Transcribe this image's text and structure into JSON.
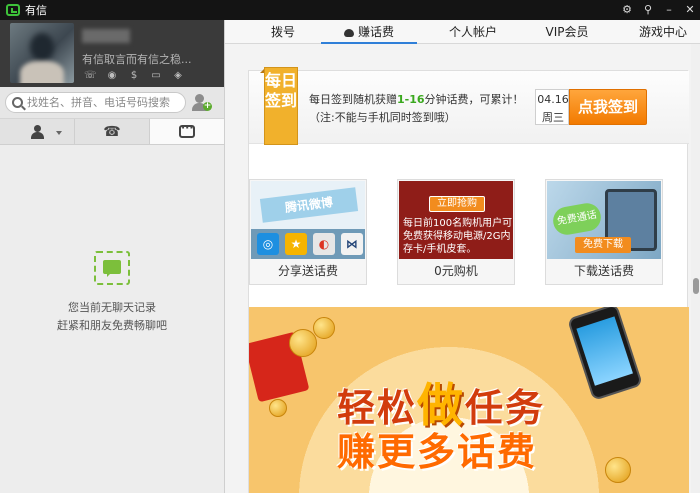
{
  "window": {
    "title": "有信",
    "controls": [
      "gear-icon",
      "pin-icon",
      "minimize-icon",
      "close-icon"
    ]
  },
  "profile": {
    "signature": "有信取言而有信之稳...",
    "icons": [
      "call-icon",
      "piggy-icon",
      "dollar-icon",
      "card-icon",
      "gamepad-icon"
    ]
  },
  "search": {
    "placeholder": "找姓名、拼音、电话号码搜索"
  },
  "left_tabs": [
    "contacts-tab",
    "calls-tab",
    "messages-tab"
  ],
  "empty_state": {
    "line1": "您当前无聊天记录",
    "line2": "赶紧和朋友免费畅聊吧"
  },
  "nav": {
    "tabs": [
      {
        "label": "拨号"
      },
      {
        "label": "赚话费"
      },
      {
        "label": "个人帐户"
      },
      {
        "label": "VIP会员"
      },
      {
        "label": "游戏中心"
      }
    ],
    "active": 1
  },
  "signin": {
    "badge": "每日签到",
    "line1_pre": "每日签到随机获赠",
    "line1_range": "1-16",
    "line1_post": "分钟话费，可累计！",
    "line2": "（注:不能与手机同时签到哦）",
    "date": "04.16",
    "weekday": "周三",
    "button": "点我签到"
  },
  "promos": [
    {
      "caption": "分享送话费",
      "banner_text": "腾讯微博"
    },
    {
      "caption": "0元购机",
      "button": "立即抢购",
      "text": "每日前100名购机用户可免费获得移动电源/2G内存卡/手机皮套。"
    },
    {
      "caption": "下载送话费",
      "badge": "免费通话",
      "button": "免费下载"
    }
  ],
  "banner": {
    "line1_a": "轻松",
    "line1_em": "做",
    "line1_b": "任务",
    "line2": "赚更多话费"
  },
  "colors": {
    "accent_green": "#3ec23a",
    "signin_orange": "#f27a00",
    "nav_active": "#2f7fd8"
  }
}
